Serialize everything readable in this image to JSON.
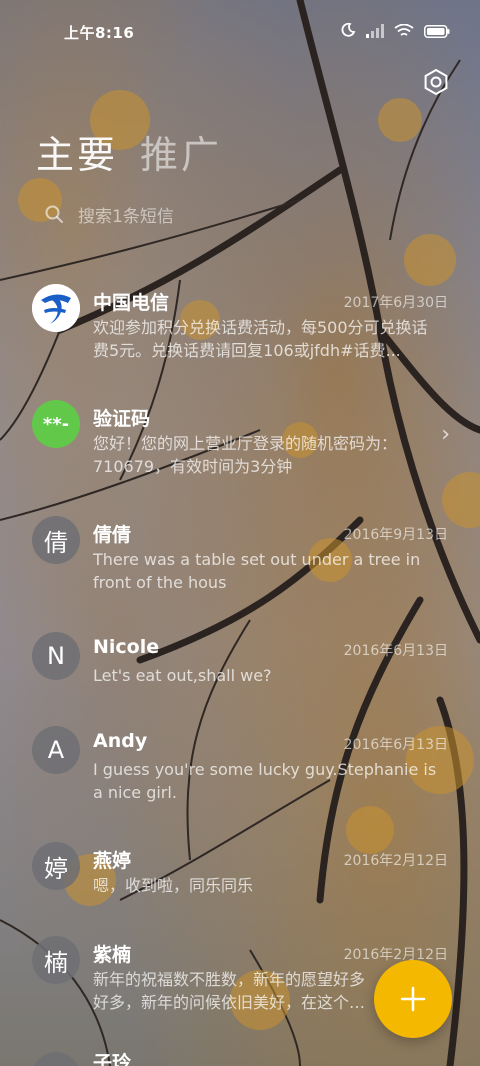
{
  "status_bar": {
    "time": "上午8:16",
    "icons": [
      "moon-icon",
      "signal-icon",
      "wifi-icon",
      "battery-icon"
    ]
  },
  "header": {
    "settings_icon": "gear-icon",
    "tabs": [
      {
        "label": "主要",
        "active": true
      },
      {
        "label": "推广",
        "active": false
      }
    ]
  },
  "search": {
    "placeholder": "搜索1条短信",
    "icon": "search-icon"
  },
  "conversations": [
    {
      "name": "中国电信",
      "date": "2017年6月30日",
      "preview": "欢迎参加积分兑换话费活动，每500分可兑换话费5元。兑换话费请回复106或jfdh#话费...",
      "avatar": "",
      "avatar_type": "logo"
    },
    {
      "name": "验证码",
      "date": "",
      "preview": "您好！您的网上营业厅登录的随机密码为：710679，有效时间为3分钟",
      "avatar": "**-",
      "avatar_type": "verification",
      "chevron": "›"
    },
    {
      "name": "倩倩",
      "date": "2016年9月13日",
      "preview": "There was a table set out under a tree in front of the hous",
      "avatar": "倩"
    },
    {
      "name": "Nicole",
      "date": "2016年6月13日",
      "preview": "Let's eat out,shall we?",
      "avatar": "N"
    },
    {
      "name": "Andy",
      "date": "2016年6月13日",
      "preview": "I guess you're some lucky guy.Stephanie is a nice girl.",
      "avatar": "A"
    },
    {
      "name": "燕婷",
      "date": "2016年2月12日",
      "preview": "嗯，收到啦，同乐同乐",
      "avatar": "婷"
    },
    {
      "name": "紫楠",
      "date": "2016年2月12日",
      "preview": "新年的祝福数不胜数，新年的愿望好多好多，新年的问候依旧美好，在这个温馨的日子里",
      "avatar": "楠"
    },
    {
      "name": "子玲",
      "date": "",
      "preview": "",
      "avatar": "玲"
    }
  ],
  "fab": {
    "icon": "plus-icon",
    "color": "#f5b800"
  },
  "colors": {
    "fab": "#f5b800",
    "verification_avatar": "#62c84a",
    "telecom_blue": "#1a5fc8"
  }
}
